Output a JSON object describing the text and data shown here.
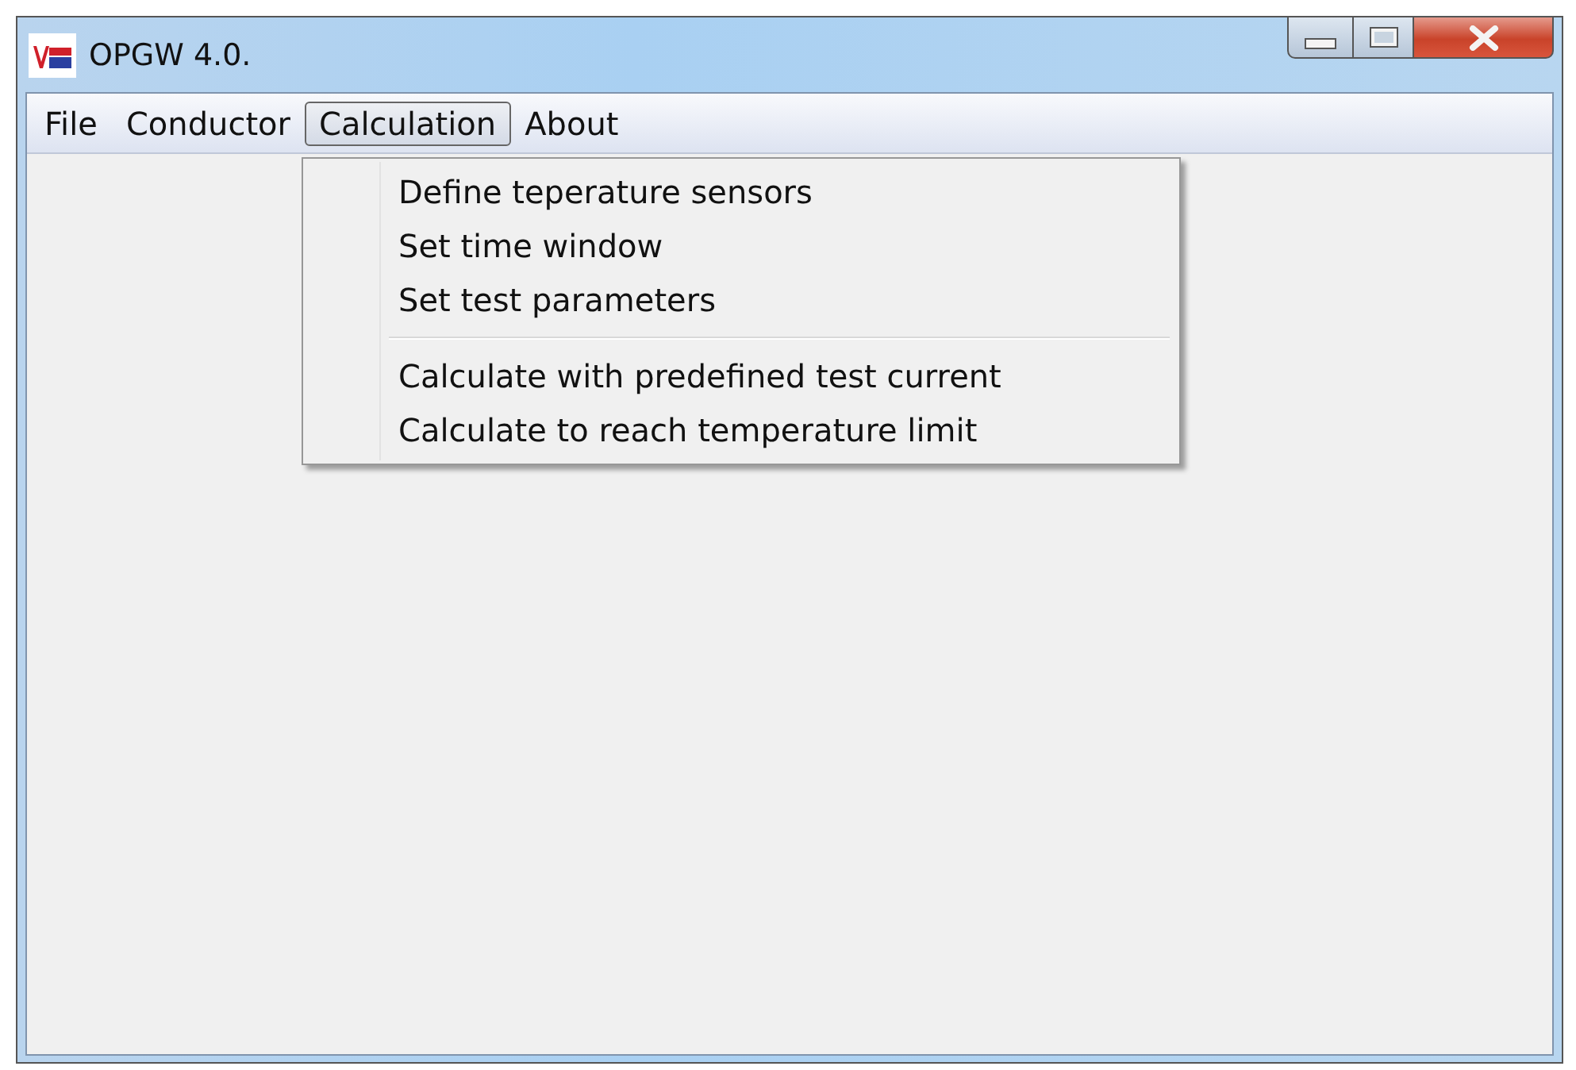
{
  "window": {
    "title": "OPGW 4.0."
  },
  "menu_bar": [
    {
      "label": "File",
      "selected": false
    },
    {
      "label": "Conductor",
      "selected": false
    },
    {
      "label": "Calculation",
      "selected": true
    },
    {
      "label": "About",
      "selected": false
    }
  ],
  "dropdown": [
    {
      "kind": "item",
      "label": "Define teperature sensors"
    },
    {
      "kind": "item",
      "label": "Set time window"
    },
    {
      "kind": "item",
      "label": "Set test parameters"
    },
    {
      "kind": "separator"
    },
    {
      "kind": "item",
      "label": "Calculate with predefined test current"
    },
    {
      "kind": "item",
      "label": "Calculate to reach temperature limit"
    }
  ]
}
